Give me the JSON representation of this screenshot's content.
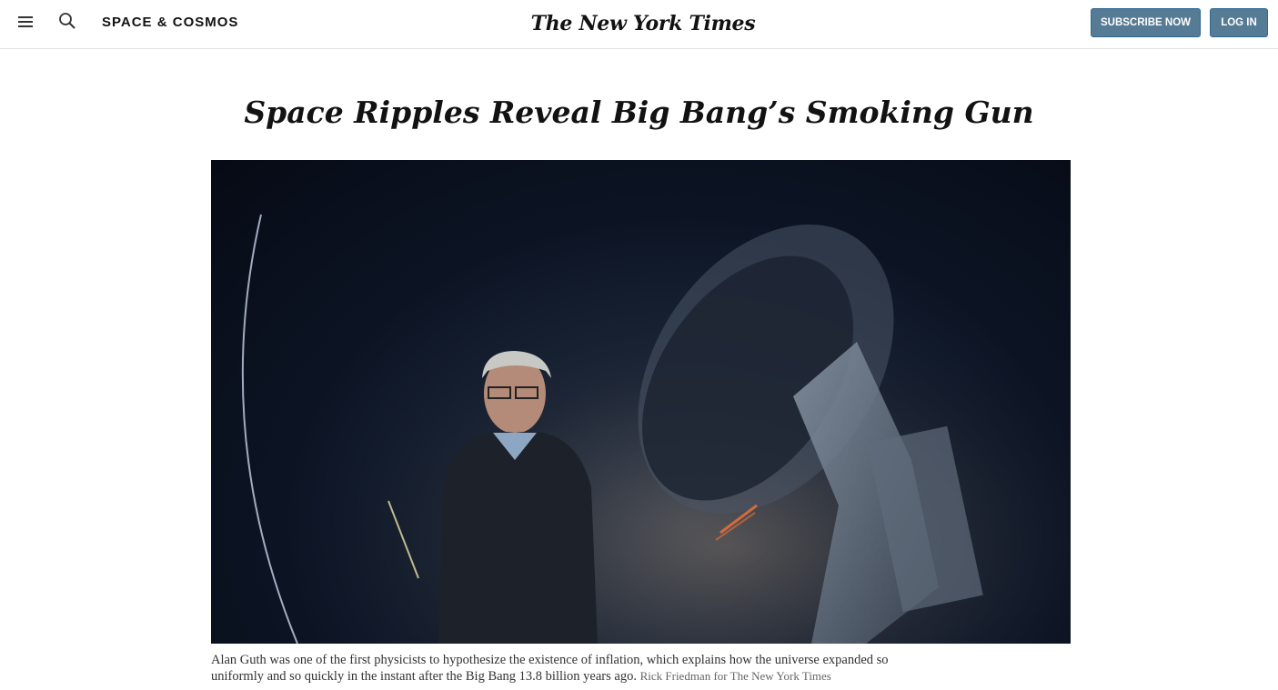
{
  "header": {
    "section_label": "SPACE & COSMOS",
    "logo_text": "The New York Times",
    "subscribe_label": "SUBSCRIBE NOW",
    "login_label": "LOG IN",
    "menu_icon": "hamburger-menu-icon",
    "search_icon": "search-icon"
  },
  "article": {
    "headline": "Space Ripples Reveal Big Bang’s Smoking Gun",
    "caption": "Alan Guth was one of the first physicists to hypothesize the existence of inflation, which explains how the universe expanded so uniformly and so quickly in the instant after the Big Bang 13.8 billion years ago.",
    "credit": "Rick Friedman for The New York Times"
  },
  "colors": {
    "button_bg": "#567b95",
    "button_text": "#ffffff",
    "text": "#121212",
    "caption_text": "#333333",
    "credit_text": "#666666"
  }
}
